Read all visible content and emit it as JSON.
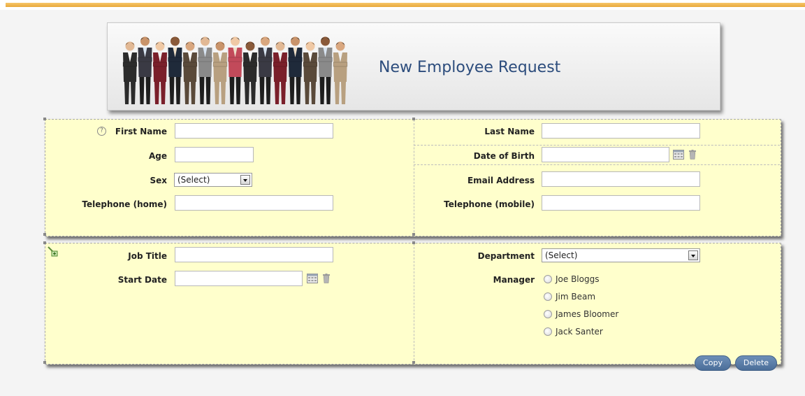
{
  "header": {
    "title": "New Employee Request",
    "accent": "#2c4c7c"
  },
  "personal": {
    "first_name": {
      "label": "First Name",
      "value": ""
    },
    "last_name": {
      "label": "Last Name",
      "value": ""
    },
    "age": {
      "label": "Age",
      "value": ""
    },
    "dob": {
      "label": "Date of Birth",
      "value": ""
    },
    "sex": {
      "label": "Sex",
      "selected": "(Select)"
    },
    "email": {
      "label": "Email Address",
      "value": ""
    },
    "tel_home": {
      "label": "Telephone (home)",
      "value": ""
    },
    "tel_mobile": {
      "label": "Telephone (mobile)",
      "value": ""
    }
  },
  "job": {
    "job_title": {
      "label": "Job Title",
      "value": ""
    },
    "start_date": {
      "label": "Start Date",
      "value": ""
    },
    "department": {
      "label": "Department",
      "selected": "(Select)"
    },
    "manager": {
      "label": "Manager",
      "options": [
        "Joe Bloggs",
        "Jim Beam",
        "James Bloomer",
        "Jack Santer"
      ]
    }
  },
  "actions": {
    "copy": "Copy",
    "delete": "Delete"
  },
  "icons": [
    "help-icon",
    "calendar-icon",
    "trash-icon",
    "add-section-icon",
    "chevron-down-icon"
  ],
  "colors": {
    "panel_bg": "#ffffcc",
    "button": "#5a7ca6",
    "top_stripe": "#f0b850"
  }
}
